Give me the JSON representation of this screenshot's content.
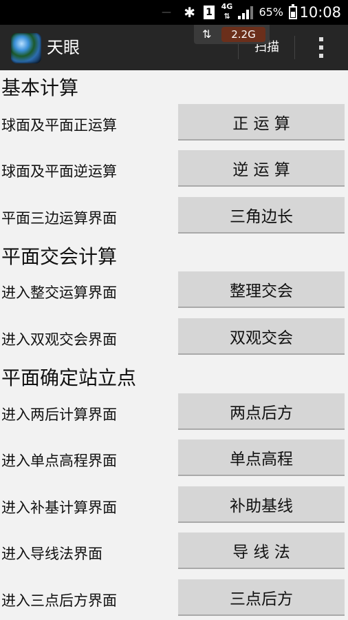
{
  "status_bar": {
    "time": "10:08",
    "battery_percent": "65%",
    "battery_level": 0.65,
    "network": "4G",
    "sim_slot": "1",
    "icons": [
      "bluetooth-icon",
      "sim-icon",
      "network-4g-icon",
      "signal-icon",
      "battery-icon"
    ]
  },
  "action_bar": {
    "title": "天眼",
    "scan_label": "扫描",
    "speed_value": "2.2G",
    "speed_arrows": "⇅",
    "background": "#262626"
  },
  "sections": [
    {
      "title": "基本计算",
      "rows": [
        {
          "label": "球面及平面正运算",
          "button": "正 运 算"
        },
        {
          "label": "球面及平面逆运算",
          "button": "逆 运 算"
        },
        {
          "label": "平面三边运算界面",
          "button": "三角边长"
        }
      ]
    },
    {
      "title": "平面交会计算",
      "rows": [
        {
          "label": "进入整交运算界面",
          "button": "整理交会"
        },
        {
          "label": "进入双观交会界面",
          "button": "双观交会"
        }
      ]
    },
    {
      "title": "平面确定站立点",
      "rows": [
        {
          "label": "进入两后计算界面",
          "button": "两点后方"
        },
        {
          "label": "进入单点高程界面",
          "button": "单点高程"
        },
        {
          "label": "进入补基计算界面",
          "button": "补助基线"
        },
        {
          "label": "进入导线法界面",
          "button": "导 线 法"
        },
        {
          "label": "进入三点后方界面",
          "button": "三点后方"
        }
      ]
    }
  ],
  "colors": {
    "page_background": "#f2f2f2",
    "button_background": "#d6d6d6",
    "status_bar": "#000000"
  }
}
